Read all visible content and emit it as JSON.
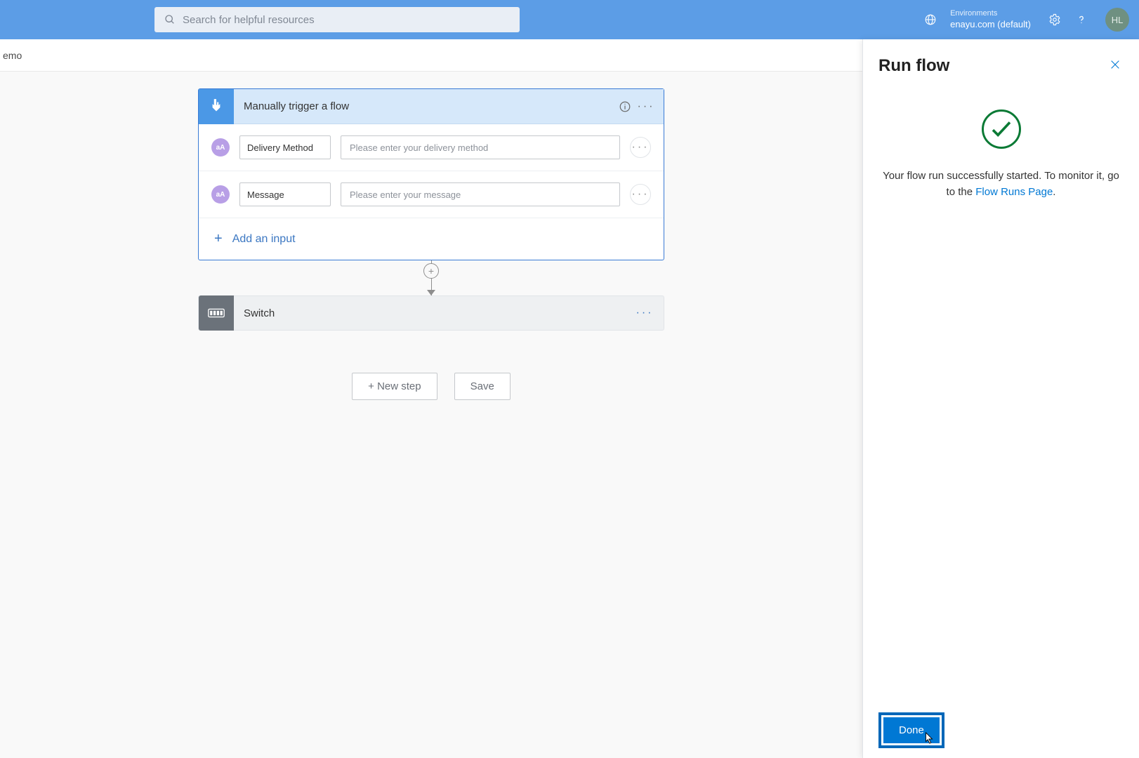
{
  "header": {
    "search_placeholder": "Search for helpful resources",
    "env_label": "Environments",
    "env_name": "enayu.com (default)",
    "avatar_initials": "HL"
  },
  "subbar": {
    "crumb": "emo"
  },
  "flow": {
    "trigger": {
      "title": "Manually trigger a flow",
      "inputs": [
        {
          "icon": "aA",
          "label": "Delivery Method",
          "placeholder": "Please enter your delivery method"
        },
        {
          "icon": "aA",
          "label": "Message",
          "placeholder": "Please enter your message"
        }
      ],
      "add_label": "Add an input"
    },
    "actions": [
      {
        "title": "Switch"
      }
    ],
    "buttons": {
      "new_step": "+ New step",
      "save": "Save"
    }
  },
  "panel": {
    "title": "Run flow",
    "message_pre": "Your flow run successfully started. To monitor it, go to the ",
    "message_link": "Flow Runs Page",
    "message_post": ".",
    "done_label": "Done"
  }
}
